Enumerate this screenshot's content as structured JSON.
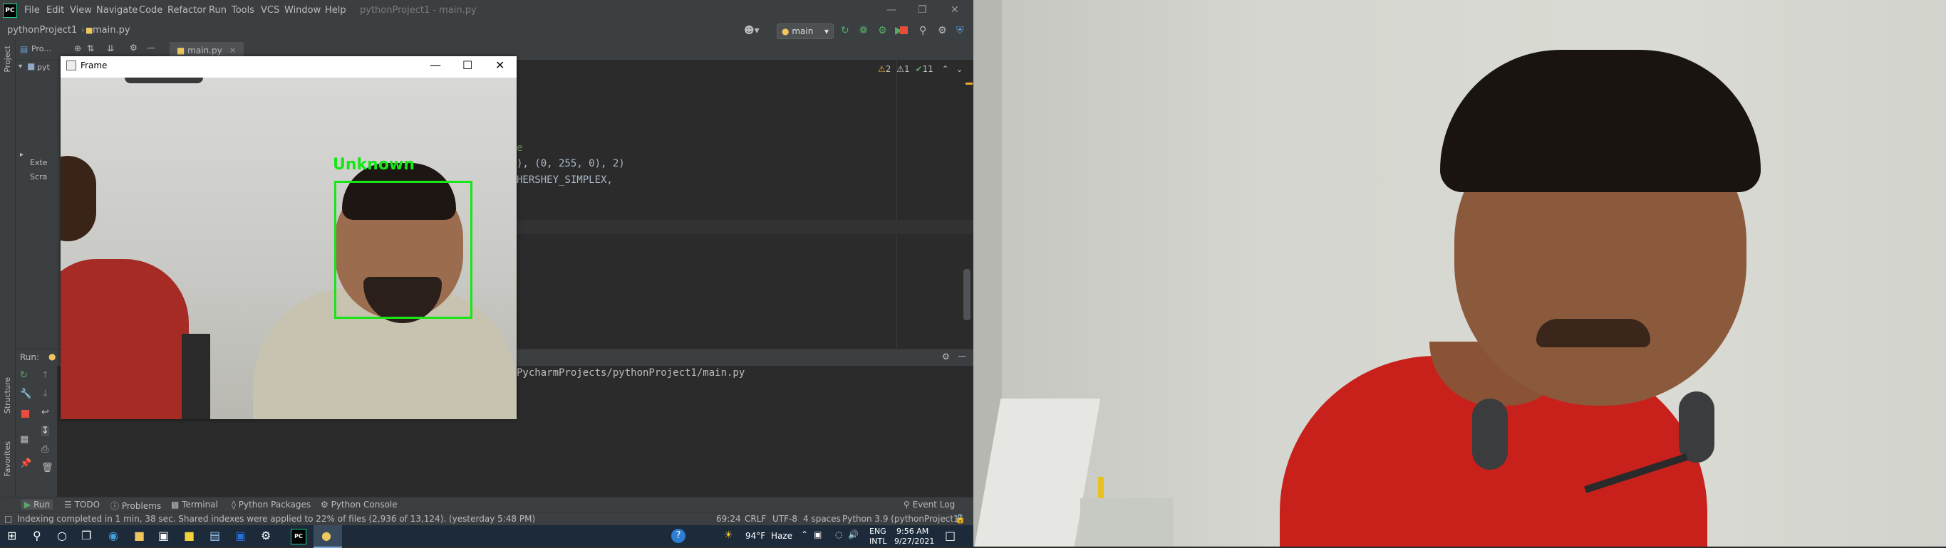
{
  "ide": {
    "menu": [
      "File",
      "Edit",
      "View",
      "Navigate",
      "Code",
      "Refactor",
      "Run",
      "Tools",
      "VCS",
      "Window",
      "Help"
    ],
    "window_title": "pythonProject1 - main.py",
    "breadcrumb": {
      "project": "pythonProject1",
      "file": "main.py"
    },
    "run_config": "main",
    "project_panel_label": "Pro...",
    "tab": "main.py",
    "tree_items": [
      "pyt",
      "Exte",
      "Scra"
    ],
    "code_lines": [
      {
        "text": "e"
      },
      {
        "text": "), (0, 255, 0), 2)"
      },
      {
        "text": "HERSHEY_SIMPLEX,"
      }
    ],
    "inspections": {
      "warn": "2",
      "weak": "1",
      "ok": "11"
    },
    "run_label": "Run:",
    "console_text": "PycharmProjects/pythonProject1/main.py",
    "bottom_tools": [
      "Run",
      "TODO",
      "Problems",
      "Terminal",
      "Python Packages",
      "Python Console",
      "Event Log"
    ],
    "status_message": "Indexing completed in 1 min, 38 sec. Shared indexes were applied to 22% of files (2,936 of 13,124). (yesterday 5:48 PM)",
    "status_right": {
      "position": "69:24",
      "line_sep": "CRLF",
      "encoding": "UTF-8",
      "indent": "4 spaces",
      "interpreter": "Python 3.9 (pythonProject1)"
    },
    "side_labels": {
      "project": "Project",
      "structure": "Structure",
      "favorites": "Favorites"
    }
  },
  "frame": {
    "title": "Frame",
    "detection_label": "Unknown"
  },
  "taskbar": {
    "weather": "94°F",
    "condition": "Haze",
    "lang": "ENG",
    "layout": "INTL",
    "time": "9:56 AM",
    "date": "9/27/2021"
  },
  "colors": {
    "detection": "#17e617",
    "accent": "#4a88c7"
  }
}
